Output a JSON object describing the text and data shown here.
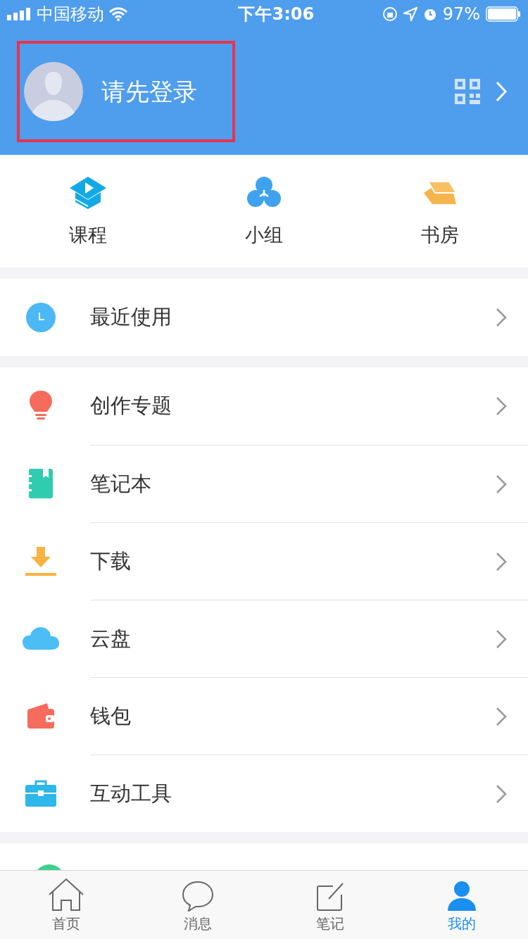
{
  "status_bar": {
    "carrier": "中国移动",
    "time": "下午3:06",
    "battery": "97%"
  },
  "profile": {
    "name": "请先登录",
    "highlighted": true
  },
  "shortcuts": [
    {
      "kind": "course",
      "label": "课程"
    },
    {
      "kind": "group",
      "label": "小组"
    },
    {
      "kind": "study",
      "label": "书房"
    }
  ],
  "sections": [
    [
      {
        "kind": "clock",
        "label": "最近使用"
      }
    ],
    [
      {
        "kind": "bulb",
        "label": "创作专题"
      },
      {
        "kind": "notebook",
        "label": "笔记本"
      },
      {
        "kind": "download",
        "label": "下载"
      },
      {
        "kind": "cloud",
        "label": "云盘"
      },
      {
        "kind": "wallet",
        "label": "钱包"
      },
      {
        "kind": "toolbox",
        "label": "互动工具"
      }
    ]
  ],
  "tabs": [
    {
      "kind": "home",
      "label": "首页",
      "selected": false
    },
    {
      "kind": "message",
      "label": "消息",
      "selected": false
    },
    {
      "kind": "note",
      "label": "笔记",
      "selected": false
    },
    {
      "kind": "me",
      "label": "我的",
      "selected": true
    }
  ]
}
